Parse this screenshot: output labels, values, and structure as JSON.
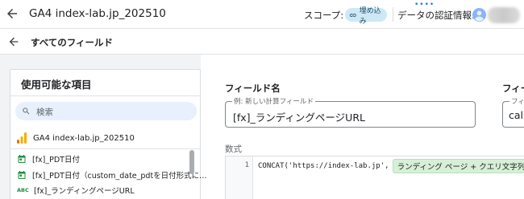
{
  "header": {
    "title": "GA4 index-lab.jp_202510",
    "scope_label": "スコープ:",
    "scope_chip": "埋め込み",
    "credentials_label": "データの認証情報:",
    "dots": "••••"
  },
  "subheader": {
    "label": "すべてのフィールド"
  },
  "left_panel": {
    "heading": "使用可能な項目",
    "search_placeholder": "検索",
    "data_source": "GA4 index-lab.jp_202510",
    "fields": [
      {
        "type": "date",
        "type_label": "",
        "label": "[fx]_PDT日付"
      },
      {
        "type": "date",
        "type_label": "",
        "label": "[fx]_PDT日付（custom_date_pdtを日付形式に…"
      },
      {
        "type": "text",
        "type_label": "ABC",
        "label": "[fx]_ランディングページURL"
      }
    ]
  },
  "editor": {
    "field_name_label": "フィールド名",
    "field_name_legend": "例: 新しい計算フィールド",
    "field_name_value": "[fx]_ランディングページURL",
    "field_id_label": "フィー",
    "field_id_legend": "フィ",
    "field_id_value": "cal",
    "formula_label": "数式",
    "line_number": "1",
    "code_prefix": "CONCAT('https://index-lab.jp',",
    "code_pill": "ランディング ページ + クエリ文字列",
    "code_suffix": ")"
  }
}
